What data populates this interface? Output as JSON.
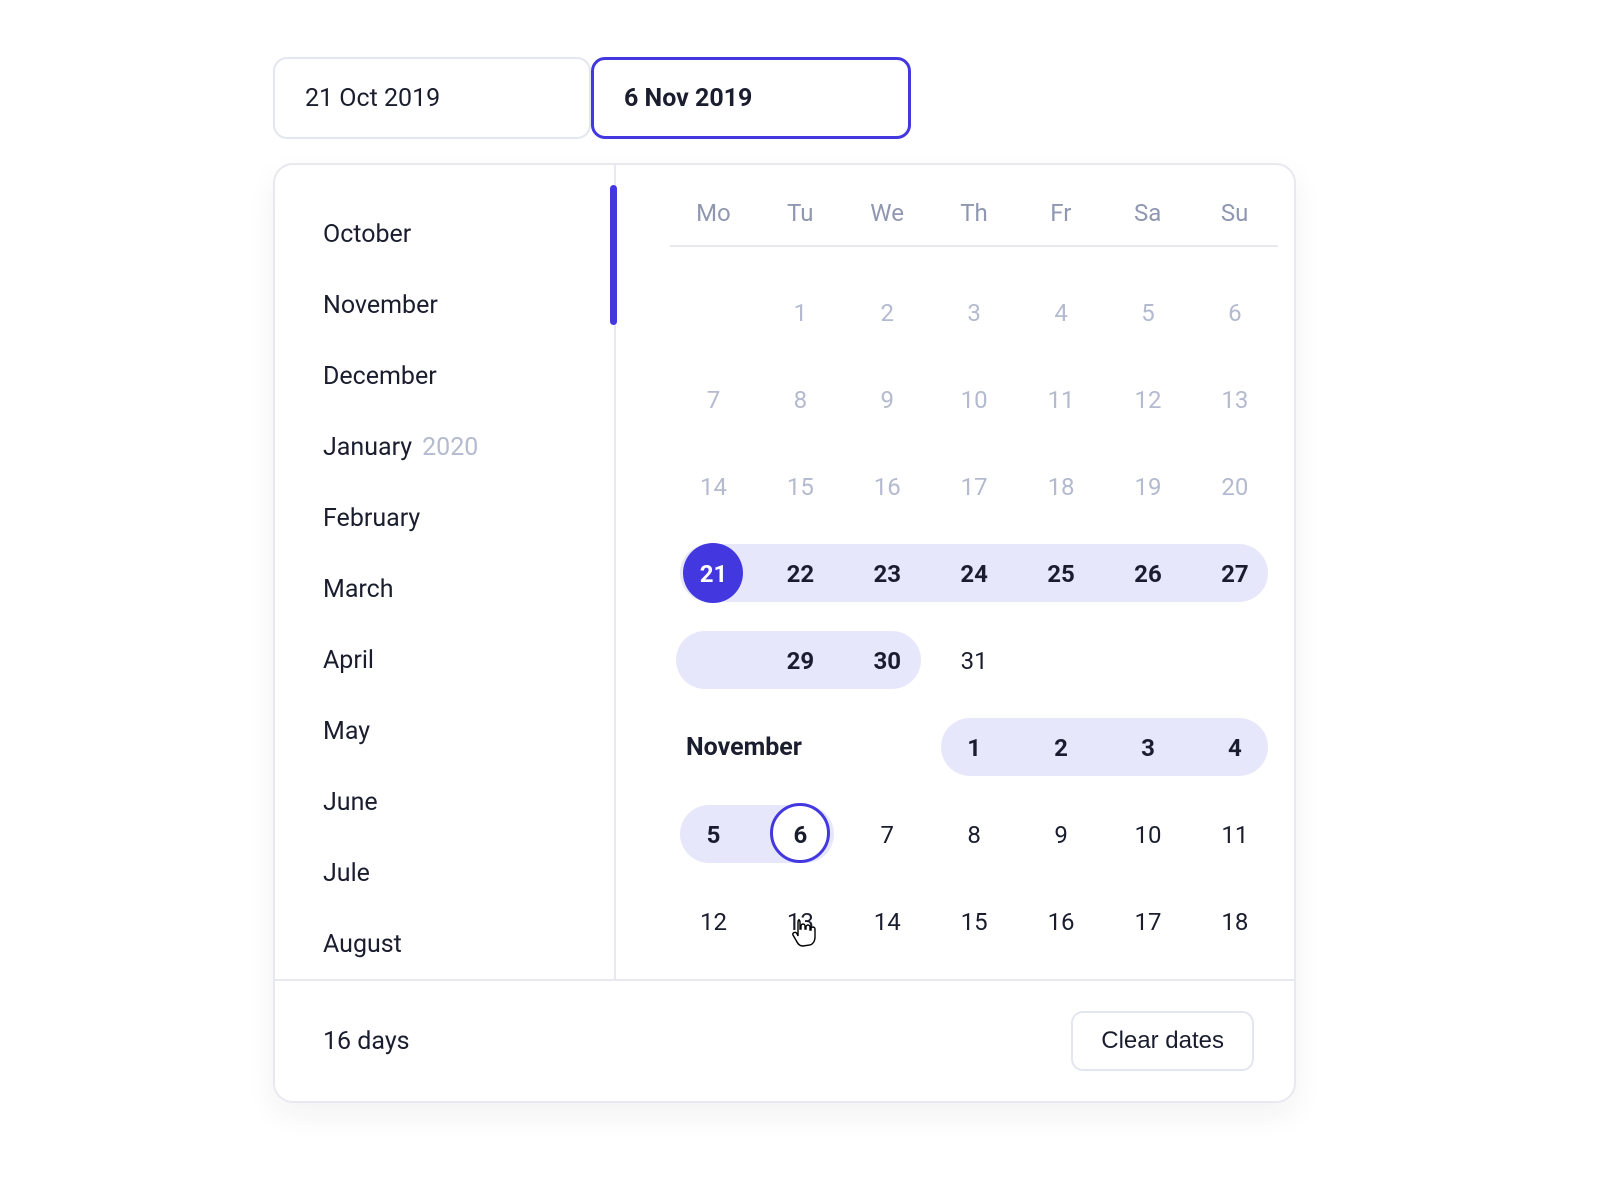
{
  "colors": {
    "accent": "#4338e0",
    "range": "#e7e7fb"
  },
  "fields": {
    "start": "21 Oct 2019",
    "end": "6 Nov 2019"
  },
  "month_list": [
    {
      "label": "October"
    },
    {
      "label": "November"
    },
    {
      "label": "December"
    },
    {
      "label": "January",
      "year_suffix": "2020"
    },
    {
      "label": "February"
    },
    {
      "label": "March"
    },
    {
      "label": "April"
    },
    {
      "label": "May"
    },
    {
      "label": "June"
    },
    {
      "label": "Jule"
    },
    {
      "label": "August"
    }
  ],
  "dow": [
    "Mo",
    "Tu",
    "We",
    "Th",
    "Fr",
    "Sa",
    "Su"
  ],
  "rows": [
    {
      "cells": [
        "",
        "1",
        "2",
        "3",
        "4",
        "5",
        "6"
      ],
      "muted": true
    },
    {
      "cells": [
        "7",
        "8",
        "9",
        "10",
        "11",
        "12",
        "13"
      ],
      "muted": true
    },
    {
      "cells": [
        "14",
        "15",
        "16",
        "17",
        "18",
        "19",
        "20"
      ],
      "muted": true
    },
    {
      "cells": [
        "21",
        "22",
        "23",
        "24",
        "25",
        "26",
        "27"
      ],
      "range": {
        "from": 0,
        "to": 6,
        "start_endpoint": 0
      }
    },
    {
      "cells": [
        "",
        "29",
        "30",
        "31",
        "",
        "",
        ""
      ],
      "range": {
        "from": 0,
        "to": 2
      },
      "first_blank_in_range": true
    },
    {
      "month_title": "November",
      "title_span": 3,
      "cells": [
        "",
        "",
        "",
        "1",
        "2",
        "3",
        "4"
      ],
      "range": {
        "from": 3,
        "to": 6
      }
    },
    {
      "cells": [
        "5",
        "6",
        "7",
        "8",
        "9",
        "10",
        "11"
      ],
      "range": {
        "from": 0,
        "to": 1,
        "end_endpoint": 1
      }
    },
    {
      "cells": [
        "12",
        "13",
        "14",
        "15",
        "16",
        "17",
        "18"
      ]
    }
  ],
  "footer": {
    "days_label": "16 days",
    "clear_label": "Clear dates"
  }
}
